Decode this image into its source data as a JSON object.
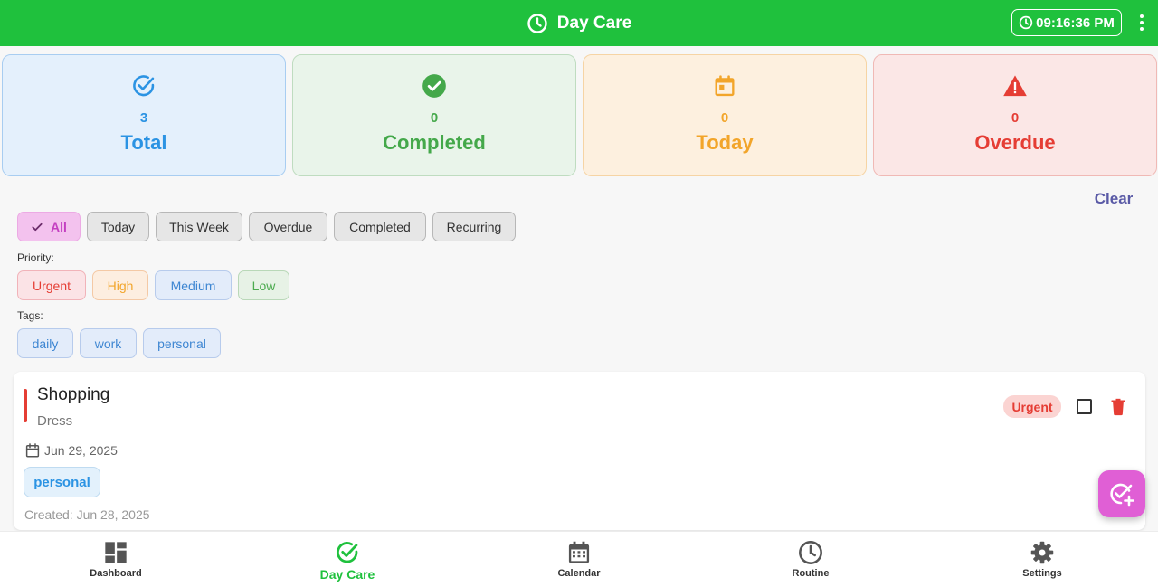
{
  "colors": {
    "primary": "#1fc13d",
    "urgent": "#e53d34",
    "accent": "#e05fd5"
  },
  "header": {
    "title": "Day Care",
    "time": "09:16:36 PM",
    "icon": "clock-icon"
  },
  "stats": [
    {
      "count": "3",
      "label": "Total",
      "icon": "check-circle-outline-icon"
    },
    {
      "count": "0",
      "label": "Completed",
      "icon": "check-circle-filled-icon"
    },
    {
      "count": "0",
      "label": "Today",
      "icon": "calendar-today-icon"
    },
    {
      "count": "0",
      "label": "Overdue",
      "icon": "warning-icon"
    }
  ],
  "clear_label": "Clear",
  "filters": [
    "All",
    "Today",
    "This Week",
    "Overdue",
    "Completed",
    "Recurring"
  ],
  "priority_label": "Priority:",
  "priorities": [
    "Urgent",
    "High",
    "Medium",
    "Low"
  ],
  "tags_label": "Tags:",
  "tags": [
    "daily",
    "work",
    "personal"
  ],
  "task": {
    "title": "Shopping",
    "description": "Dress",
    "date": "Jun 29, 2025",
    "tag": "personal",
    "created": "Created: Jun 28, 2025",
    "priority": "Urgent",
    "completed": false
  },
  "nav": [
    {
      "label": "Dashboard",
      "icon": "dashboard-icon"
    },
    {
      "label": "Day Care",
      "icon": "check-circle-outline-icon",
      "active": true
    },
    {
      "label": "Calendar",
      "icon": "calendar-icon"
    },
    {
      "label": "Routine",
      "icon": "clock-icon"
    },
    {
      "label": "Settings",
      "icon": "gear-icon"
    }
  ]
}
